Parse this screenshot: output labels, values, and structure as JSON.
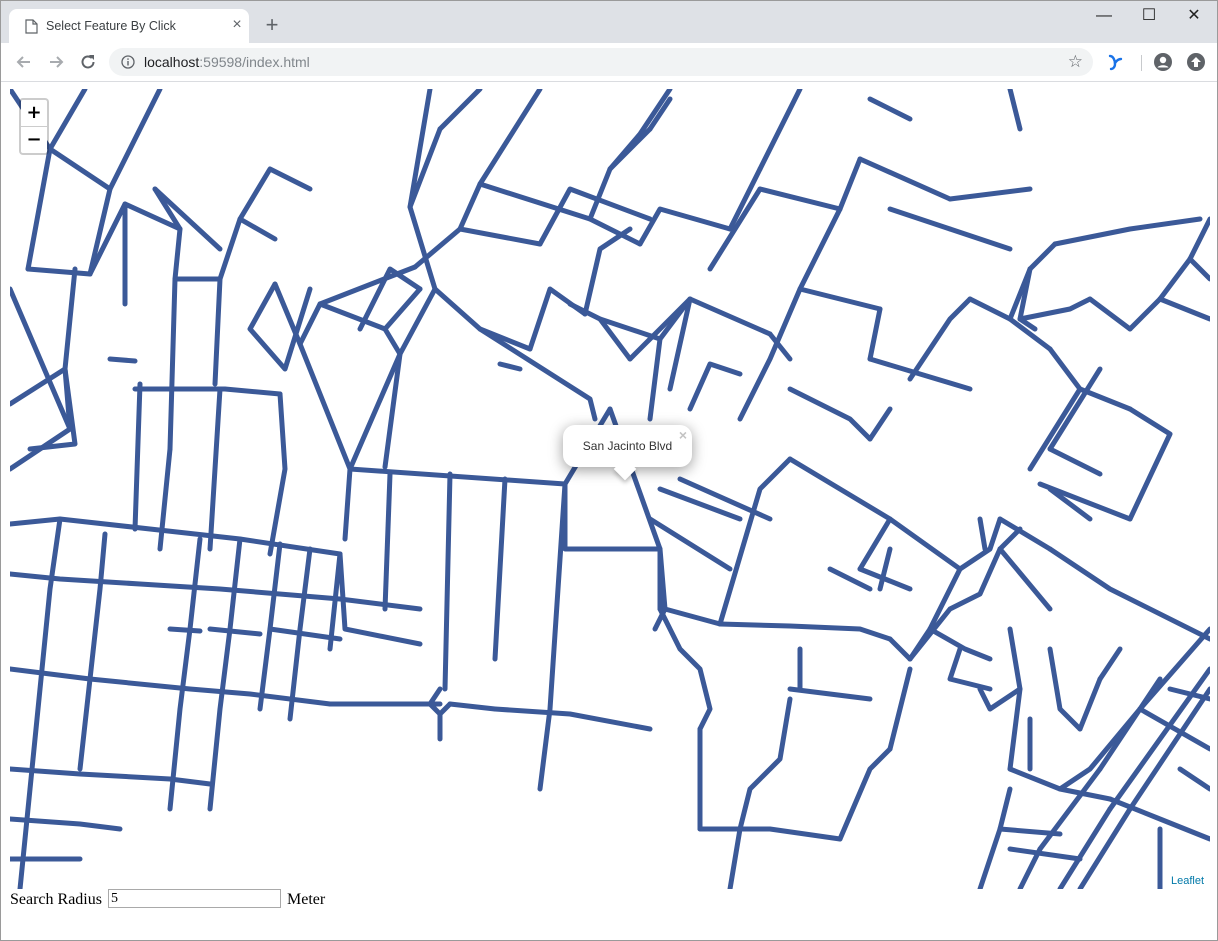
{
  "browser": {
    "tab_title": "Select Feature By Click",
    "tab_close": "×",
    "new_tab": "+",
    "url_host": "localhost",
    "url_rest": ":59598/index.html",
    "window_controls": {
      "minimize": "—",
      "maximize": "☐",
      "close": "✕"
    }
  },
  "map": {
    "zoom_in": "+",
    "zoom_out": "−",
    "popup_text": "San Jacinto Blvd",
    "popup_close": "×",
    "attribution": "Leaflet",
    "road_color": "#3b5998"
  },
  "search": {
    "label": "Search Radius",
    "value": "5",
    "unit": "Meter"
  }
}
